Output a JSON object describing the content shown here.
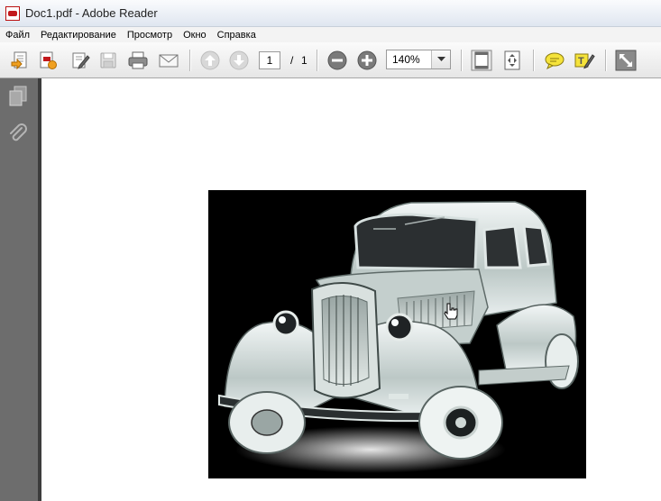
{
  "window": {
    "title": "Doc1.pdf - Adobe Reader"
  },
  "menu": [
    "Файл",
    "Редактирование",
    "Просмотр",
    "Окно",
    "Справка"
  ],
  "toolbar": {
    "page_current": "1",
    "page_separator": "/",
    "page_total": "1",
    "zoom": "140%"
  },
  "colors": {
    "toolbar_bg": "#e9e9e9",
    "nav_pane": "#6d6d6d",
    "document_bg": "#ffffff",
    "pdf_red": "#c2191c"
  },
  "icons": [
    "pdf-file-icon",
    "open-icon",
    "create-pdf-icon",
    "edit-icon",
    "save-icon",
    "print-icon",
    "email-icon",
    "prev-page-icon",
    "next-page-icon",
    "zoom-out-icon",
    "zoom-in-icon",
    "chevron-down-icon",
    "fit-page-icon",
    "fit-width-icon",
    "comment-icon",
    "highlight-icon",
    "fullscreen-icon",
    "pages-icon",
    "paperclip-icon",
    "hand-cursor-icon"
  ]
}
